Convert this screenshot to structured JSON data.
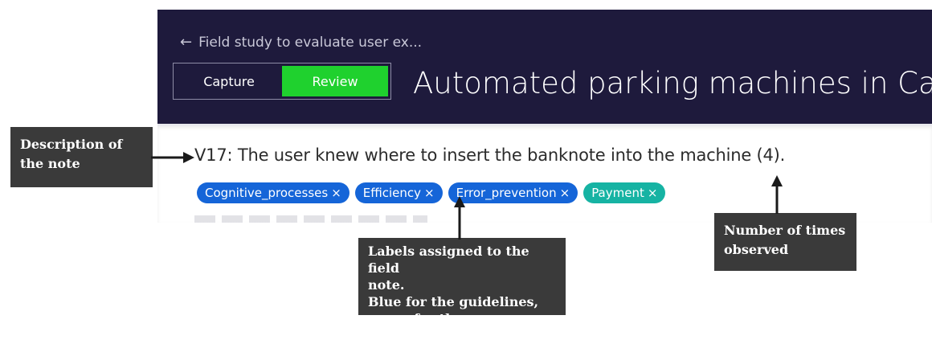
{
  "header": {
    "back_link": "Field study to evaluate user ex...",
    "back_icon": "arrow-left-icon",
    "mode_tabs": [
      {
        "label": "Capture",
        "active": false
      },
      {
        "label": "Review",
        "active": true
      }
    ],
    "title": "Automated parking machines in Cali"
  },
  "note": {
    "text": "V17: The user knew where to insert the banknote into the machine (4).",
    "tags": [
      {
        "label": "Cognitive_processes",
        "color": "#1565d8"
      },
      {
        "label": "Efficiency",
        "color": "#1565d8"
      },
      {
        "label": "Error_prevention",
        "color": "#1565d8"
      },
      {
        "label": "Payment",
        "color": "#16b3a3"
      }
    ],
    "remove_symbol": "×"
  },
  "callouts": {
    "description": [
      "Description of",
      "the note"
    ],
    "labels": [
      "Labels assigned to the field",
      "note.",
      "Blue for the guidelines,",
      "green for the touchpoints."
    ],
    "count": [
      "Number of times",
      "observed"
    ]
  },
  "colors": {
    "header_bg": "#1e1a3c",
    "review_active": "#1fd12e",
    "guideline_tag": "#1565d8",
    "touchpoint_tag": "#16b3a3",
    "callout_bg": "#3a3a3a"
  }
}
